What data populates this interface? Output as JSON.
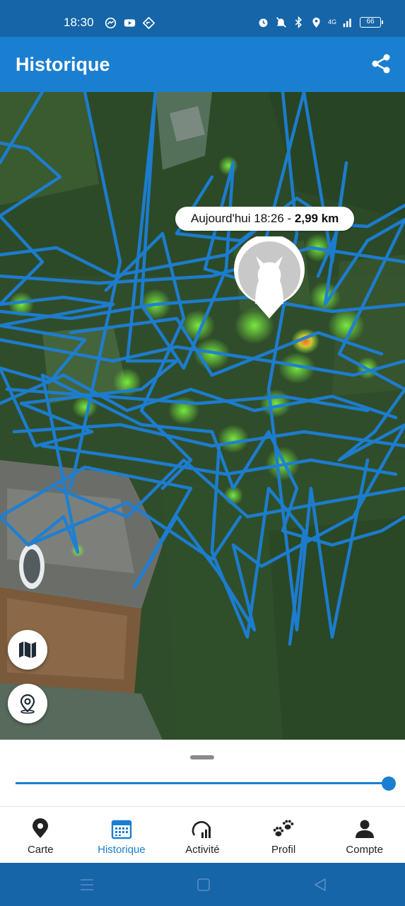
{
  "status_bar": {
    "time": "18:30",
    "left_icons": [
      "messenger-icon",
      "youtube-icon",
      "navigation-icon"
    ],
    "right_icons": [
      "alarm-icon",
      "mute-icon",
      "bluetooth-icon",
      "location-icon",
      "signal-icon"
    ],
    "network": "4G",
    "battery": "66"
  },
  "app_bar": {
    "title": "Historique",
    "share_icon": "share-icon"
  },
  "map": {
    "tooltip_date": "Aujourd'hui 18:26 - ",
    "tooltip_distance": "2,99 km",
    "marker_icon": "cat-avatar-icon",
    "route_color": "#1c7fd6",
    "heat_color": "#66dd33",
    "hotspot_color": "#f07020",
    "layers_button_icon": "map-icon",
    "location_button_icon": "location-pin-icon"
  },
  "timeline": {
    "slider_value": 1.0
  },
  "bottom_nav": {
    "items": [
      {
        "label": "Carte",
        "icon": "map-pin-icon",
        "active": false
      },
      {
        "label": "Historique",
        "icon": "calendar-icon",
        "active": true
      },
      {
        "label": "Activité",
        "icon": "activity-gauge-icon",
        "active": false
      },
      {
        "label": "Profil",
        "icon": "paws-icon",
        "active": false
      },
      {
        "label": "Compte",
        "icon": "person-icon",
        "active": false
      }
    ]
  },
  "system_nav": {
    "buttons": [
      "menu-icon",
      "home-icon",
      "back-icon"
    ]
  },
  "colors": {
    "primary": "#1a7fd0",
    "status_bar": "#1565a8"
  }
}
